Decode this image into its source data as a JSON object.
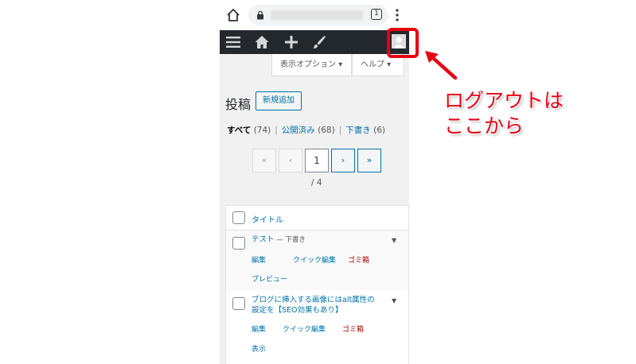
{
  "browser": {
    "tab_count": "1"
  },
  "screen_options": {
    "display_options": "表示オプション ▾",
    "help": "ヘルプ ▾"
  },
  "page": {
    "title": "投稿",
    "add_new": "新規追加"
  },
  "filters": {
    "all": "すべて",
    "all_count": "(74)",
    "published": "公開済み",
    "published_count": "(68)",
    "drafts": "下書き",
    "drafts_count": "(6)",
    "separator": "|"
  },
  "pagination": {
    "first": "«",
    "prev": "‹",
    "current": "1",
    "next": "›",
    "last": "»",
    "total": "/ 4"
  },
  "table": {
    "column_title": "タイトル",
    "rows": [
      {
        "title": "テスト",
        "state": " — 下書き",
        "actions": {
          "edit": "編集",
          "quick_edit": "クイック編集",
          "trash": "ゴミ箱",
          "preview": "プレビュー"
        }
      },
      {
        "title_line1": "ブログに挿入する画像にはalt属性の",
        "title_line2": "設定を【SEO効果もあり】",
        "actions": {
          "edit": "編集",
          "quick_edit": "クイック編集",
          "trash": "ゴミ箱",
          "view": "表示"
        }
      }
    ]
  },
  "annotation": {
    "callout": "ログアウトは\nここから",
    "color": "#e60012"
  },
  "colors": {
    "admin_bar": "#23282d",
    "link": "#0073aa",
    "trash": "#aa0000"
  },
  "icons": [
    "home-icon",
    "lock-icon",
    "tab-switcher-icon",
    "kebab-menu-icon",
    "menu-icon",
    "dashboard-home-icon",
    "plus-icon",
    "customize-brush-icon",
    "user-avatar-icon"
  ]
}
